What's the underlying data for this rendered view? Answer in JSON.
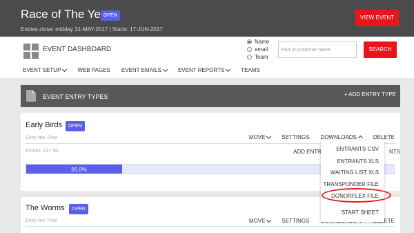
{
  "header": {
    "event_title": "Race of The Year",
    "status_badge": "OPEN",
    "entries_info": "Entries close: midday 31-MAY-2017  |  Starts: 17-JUN-2017",
    "view_event_label": "VIEW EVENT"
  },
  "nav": {
    "dashboard_title": "EVENT DASHBOARD",
    "search_options": [
      "Name",
      "email",
      "Team"
    ],
    "search_selected": "Name",
    "search_placeholder": "Part of customer name",
    "search_button": "SEARCH",
    "menu": [
      {
        "label": "EVENT SETUP",
        "has_dropdown": true
      },
      {
        "label": "WEB PAGES",
        "has_dropdown": false
      },
      {
        "label": "EVENT EMAILS",
        "has_dropdown": true
      },
      {
        "label": "EVENT REPORTS",
        "has_dropdown": true
      },
      {
        "label": "TEAMS",
        "has_dropdown": false
      }
    ]
  },
  "entry_types": {
    "title": "EVENT ENTRY TYPES",
    "add_label": "+ ADD ENTRY TYPE",
    "cards": [
      {
        "name": "Early Birds",
        "status": "OPEN",
        "fee": "Entry fee: Free",
        "actions": {
          "move": "MOVE",
          "settings": "SETTINGS",
          "downloads": "DOWNLOADS",
          "delete": "DELETE"
        },
        "entries": "Entries: 13 / 50",
        "add_entry": "ADD ENTR",
        "add_entry_tail": "NTS",
        "progress_label": "26.0%",
        "progress_value": 0.26
      },
      {
        "name": "The Worms",
        "status": "OPEN",
        "fee": "Entry fee: Free",
        "actions": {
          "move": "MOVE",
          "settings": "SETTINGS",
          "downloads": "DOWNLOADS",
          "delete": "DELETE"
        }
      }
    ]
  },
  "downloads_menu": {
    "items": [
      "ENTRANTS CSV",
      "ENTRANTS XLS",
      "WAITING LIST XLS",
      "TRANSPONDER FILE",
      "DONORFLEX FILE",
      "START SHEET"
    ],
    "highlighted": "DONORFLEX FILE"
  },
  "colors": {
    "header_bg": "#4b4b4d",
    "accent_red": "#e8161b",
    "badge_blue": "#5a5ee8"
  }
}
